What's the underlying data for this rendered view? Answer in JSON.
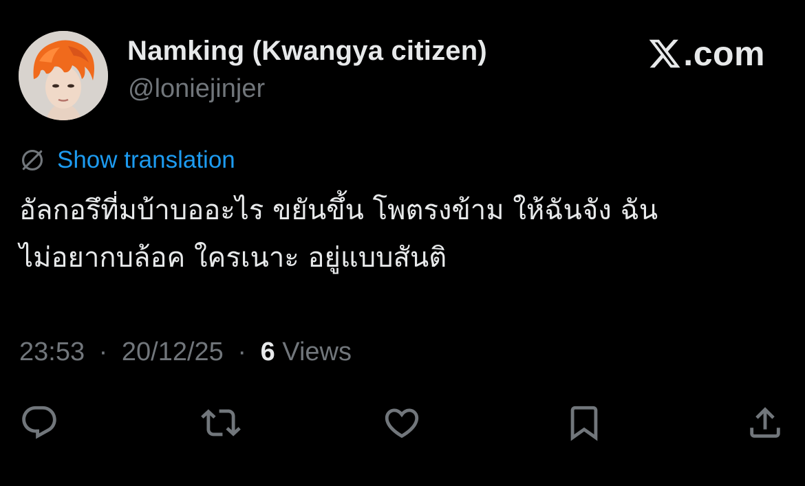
{
  "author": {
    "display_name": "Namking (Kwangya citizen)",
    "handle": "@loniejinjer",
    "avatar_icon": "profile-photo"
  },
  "brand": {
    "label": ".com",
    "logo_icon": "x-logo-icon"
  },
  "translation": {
    "icon": "globe-icon",
    "label": "Show translation"
  },
  "tweet": {
    "lines": [
      "อัลกอรึที่มบ้าบออะไร ขยันขึ้น โพตรงข้าม ให้ฉันจัง ฉัน",
      "ไม่อยากบล้อค ใครเนาะ อยู่แบบสันติ"
    ]
  },
  "meta": {
    "time": "23:53",
    "date": "20/12/25",
    "separator": "·",
    "views_count": "6",
    "views_label": "Views"
  },
  "actions": [
    {
      "name": "reply",
      "icon": "reply-icon"
    },
    {
      "name": "retweet",
      "icon": "retweet-icon"
    },
    {
      "name": "like",
      "icon": "heart-icon"
    },
    {
      "name": "bookmark",
      "icon": "bookmark-icon"
    },
    {
      "name": "share",
      "icon": "share-icon"
    }
  ],
  "colors": {
    "background": "#000000",
    "text_primary": "#e7e9ea",
    "text_secondary": "#71767b",
    "link": "#1d9bf0"
  }
}
